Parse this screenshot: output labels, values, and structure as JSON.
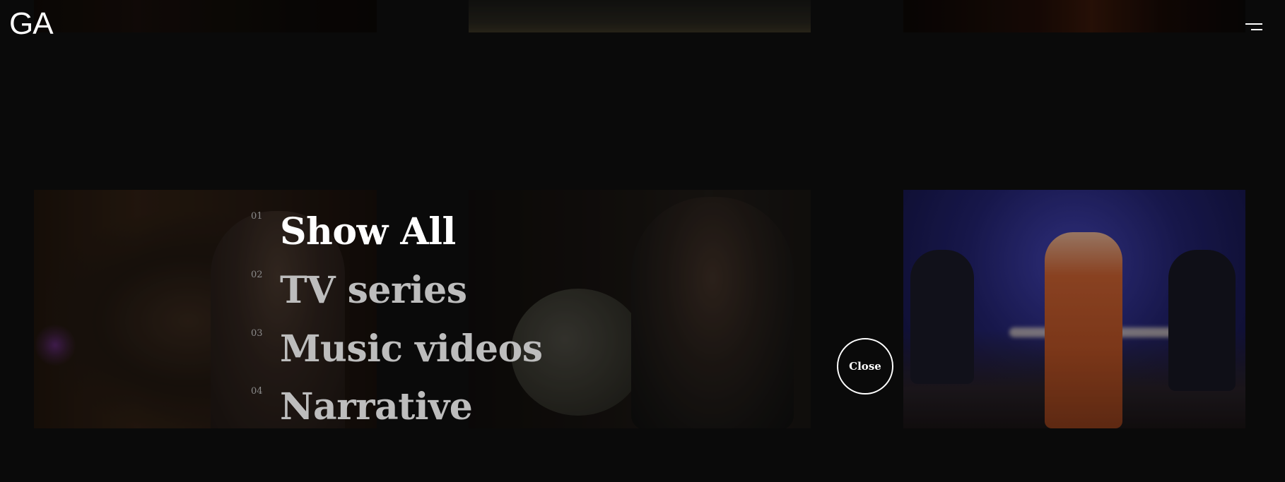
{
  "header": {
    "logo_text": "GA",
    "menu_icon": "hamburger-menu-icon"
  },
  "filter_menu": {
    "items": [
      {
        "number": "01",
        "label": "Show All",
        "active": true
      },
      {
        "number": "02",
        "label": "TV series",
        "active": false
      },
      {
        "number": "03",
        "label": "Music videos",
        "active": false
      },
      {
        "number": "04",
        "label": "Narrative",
        "active": false
      }
    ]
  },
  "close_button": {
    "label": "Close"
  },
  "colors": {
    "background": "#0b0b0b",
    "text_active": "#ffffff",
    "text_inactive": "#bdbdbd",
    "number": "#8a8a8a"
  }
}
